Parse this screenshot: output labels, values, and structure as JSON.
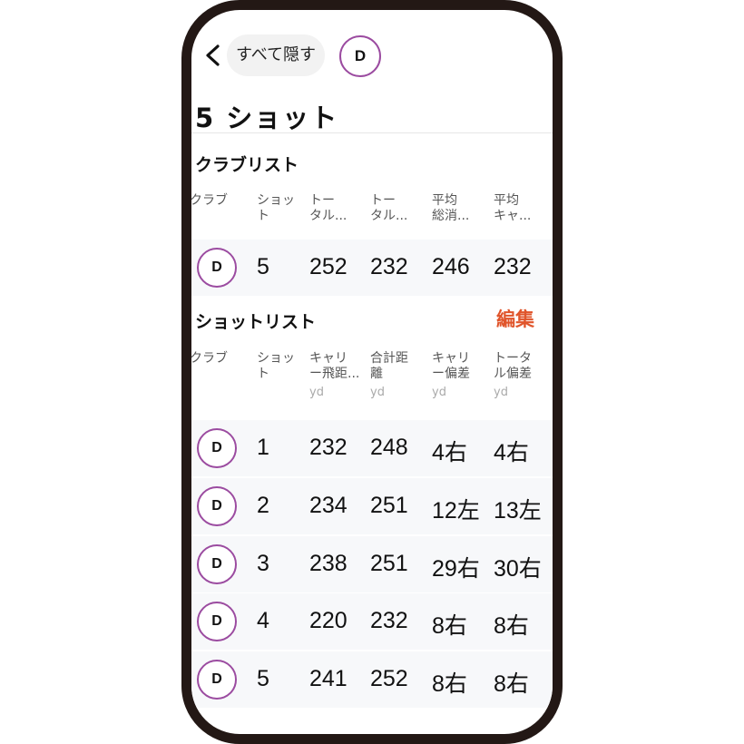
{
  "header": {
    "hide_all_label": "すべて隠す",
    "club_chip": "D"
  },
  "title": "5 ショット",
  "club_list": {
    "section_title": "クラブリスト",
    "columns": [
      [
        "クラブ"
      ],
      [
        "ショッ",
        "ト"
      ],
      [
        "トー",
        "タル..."
      ],
      [
        "トー",
        "タル..."
      ],
      [
        "平均",
        "総消..."
      ],
      [
        "平均",
        "キャ..."
      ]
    ],
    "rows": [
      {
        "club": "D",
        "cells": [
          "5",
          "252",
          "232",
          "246",
          "232"
        ]
      }
    ]
  },
  "shot_list": {
    "section_title": "ショットリスト",
    "edit_label": "編集",
    "columns": [
      [
        "クラブ"
      ],
      [
        "ショッ",
        "ト"
      ],
      [
        "キャリ",
        "ー飛距..."
      ],
      [
        "合計距",
        "離"
      ],
      [
        "キャリ",
        "ー偏差"
      ],
      [
        "トータ",
        "ル偏差"
      ]
    ],
    "units": [
      "",
      "",
      "yd",
      "yd",
      "yd",
      "yd"
    ],
    "rows": [
      {
        "club": "D",
        "cells": [
          "1",
          "232",
          "248",
          "4右",
          "4右"
        ]
      },
      {
        "club": "D",
        "cells": [
          "2",
          "234",
          "251",
          "12左",
          "13左"
        ]
      },
      {
        "club": "D",
        "cells": [
          "3",
          "238",
          "251",
          "29右",
          "30右"
        ]
      },
      {
        "club": "D",
        "cells": [
          "4",
          "220",
          "232",
          "8右",
          "8右"
        ]
      },
      {
        "club": "D",
        "cells": [
          "5",
          "241",
          "252",
          "8右",
          "8右"
        ]
      }
    ]
  }
}
